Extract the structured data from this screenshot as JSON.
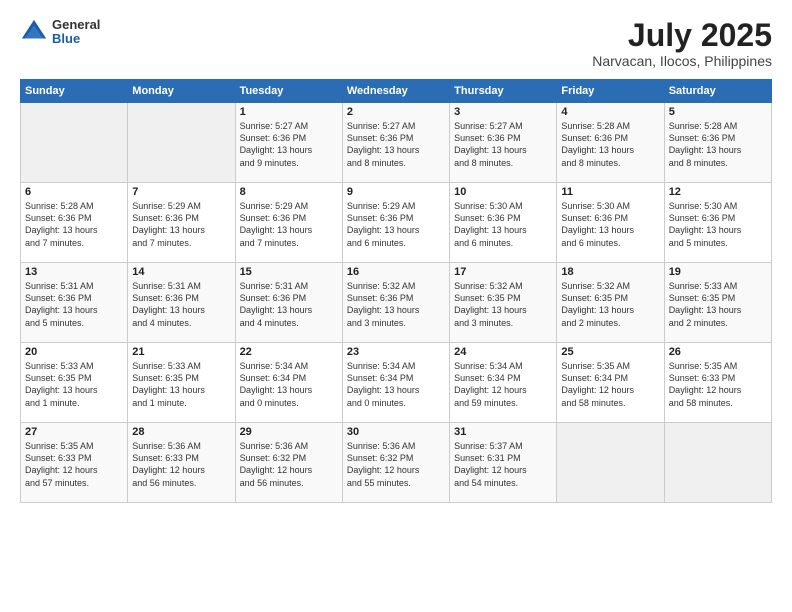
{
  "header": {
    "logo_general": "General",
    "logo_blue": "Blue",
    "month_year": "July 2025",
    "location": "Narvacan, Ilocos, Philippines"
  },
  "weekdays": [
    "Sunday",
    "Monday",
    "Tuesday",
    "Wednesday",
    "Thursday",
    "Friday",
    "Saturday"
  ],
  "weeks": [
    [
      {
        "day": "",
        "detail": ""
      },
      {
        "day": "",
        "detail": ""
      },
      {
        "day": "1",
        "detail": "Sunrise: 5:27 AM\nSunset: 6:36 PM\nDaylight: 13 hours\nand 9 minutes."
      },
      {
        "day": "2",
        "detail": "Sunrise: 5:27 AM\nSunset: 6:36 PM\nDaylight: 13 hours\nand 8 minutes."
      },
      {
        "day": "3",
        "detail": "Sunrise: 5:27 AM\nSunset: 6:36 PM\nDaylight: 13 hours\nand 8 minutes."
      },
      {
        "day": "4",
        "detail": "Sunrise: 5:28 AM\nSunset: 6:36 PM\nDaylight: 13 hours\nand 8 minutes."
      },
      {
        "day": "5",
        "detail": "Sunrise: 5:28 AM\nSunset: 6:36 PM\nDaylight: 13 hours\nand 8 minutes."
      }
    ],
    [
      {
        "day": "6",
        "detail": "Sunrise: 5:28 AM\nSunset: 6:36 PM\nDaylight: 13 hours\nand 7 minutes."
      },
      {
        "day": "7",
        "detail": "Sunrise: 5:29 AM\nSunset: 6:36 PM\nDaylight: 13 hours\nand 7 minutes."
      },
      {
        "day": "8",
        "detail": "Sunrise: 5:29 AM\nSunset: 6:36 PM\nDaylight: 13 hours\nand 7 minutes."
      },
      {
        "day": "9",
        "detail": "Sunrise: 5:29 AM\nSunset: 6:36 PM\nDaylight: 13 hours\nand 6 minutes."
      },
      {
        "day": "10",
        "detail": "Sunrise: 5:30 AM\nSunset: 6:36 PM\nDaylight: 13 hours\nand 6 minutes."
      },
      {
        "day": "11",
        "detail": "Sunrise: 5:30 AM\nSunset: 6:36 PM\nDaylight: 13 hours\nand 6 minutes."
      },
      {
        "day": "12",
        "detail": "Sunrise: 5:30 AM\nSunset: 6:36 PM\nDaylight: 13 hours\nand 5 minutes."
      }
    ],
    [
      {
        "day": "13",
        "detail": "Sunrise: 5:31 AM\nSunset: 6:36 PM\nDaylight: 13 hours\nand 5 minutes."
      },
      {
        "day": "14",
        "detail": "Sunrise: 5:31 AM\nSunset: 6:36 PM\nDaylight: 13 hours\nand 4 minutes."
      },
      {
        "day": "15",
        "detail": "Sunrise: 5:31 AM\nSunset: 6:36 PM\nDaylight: 13 hours\nand 4 minutes."
      },
      {
        "day": "16",
        "detail": "Sunrise: 5:32 AM\nSunset: 6:36 PM\nDaylight: 13 hours\nand 3 minutes."
      },
      {
        "day": "17",
        "detail": "Sunrise: 5:32 AM\nSunset: 6:35 PM\nDaylight: 13 hours\nand 3 minutes."
      },
      {
        "day": "18",
        "detail": "Sunrise: 5:32 AM\nSunset: 6:35 PM\nDaylight: 13 hours\nand 2 minutes."
      },
      {
        "day": "19",
        "detail": "Sunrise: 5:33 AM\nSunset: 6:35 PM\nDaylight: 13 hours\nand 2 minutes."
      }
    ],
    [
      {
        "day": "20",
        "detail": "Sunrise: 5:33 AM\nSunset: 6:35 PM\nDaylight: 13 hours\nand 1 minute."
      },
      {
        "day": "21",
        "detail": "Sunrise: 5:33 AM\nSunset: 6:35 PM\nDaylight: 13 hours\nand 1 minute."
      },
      {
        "day": "22",
        "detail": "Sunrise: 5:34 AM\nSunset: 6:34 PM\nDaylight: 13 hours\nand 0 minutes."
      },
      {
        "day": "23",
        "detail": "Sunrise: 5:34 AM\nSunset: 6:34 PM\nDaylight: 13 hours\nand 0 minutes."
      },
      {
        "day": "24",
        "detail": "Sunrise: 5:34 AM\nSunset: 6:34 PM\nDaylight: 12 hours\nand 59 minutes."
      },
      {
        "day": "25",
        "detail": "Sunrise: 5:35 AM\nSunset: 6:34 PM\nDaylight: 12 hours\nand 58 minutes."
      },
      {
        "day": "26",
        "detail": "Sunrise: 5:35 AM\nSunset: 6:33 PM\nDaylight: 12 hours\nand 58 minutes."
      }
    ],
    [
      {
        "day": "27",
        "detail": "Sunrise: 5:35 AM\nSunset: 6:33 PM\nDaylight: 12 hours\nand 57 minutes."
      },
      {
        "day": "28",
        "detail": "Sunrise: 5:36 AM\nSunset: 6:33 PM\nDaylight: 12 hours\nand 56 minutes."
      },
      {
        "day": "29",
        "detail": "Sunrise: 5:36 AM\nSunset: 6:32 PM\nDaylight: 12 hours\nand 56 minutes."
      },
      {
        "day": "30",
        "detail": "Sunrise: 5:36 AM\nSunset: 6:32 PM\nDaylight: 12 hours\nand 55 minutes."
      },
      {
        "day": "31",
        "detail": "Sunrise: 5:37 AM\nSunset: 6:31 PM\nDaylight: 12 hours\nand 54 minutes."
      },
      {
        "day": "",
        "detail": ""
      },
      {
        "day": "",
        "detail": ""
      }
    ]
  ]
}
